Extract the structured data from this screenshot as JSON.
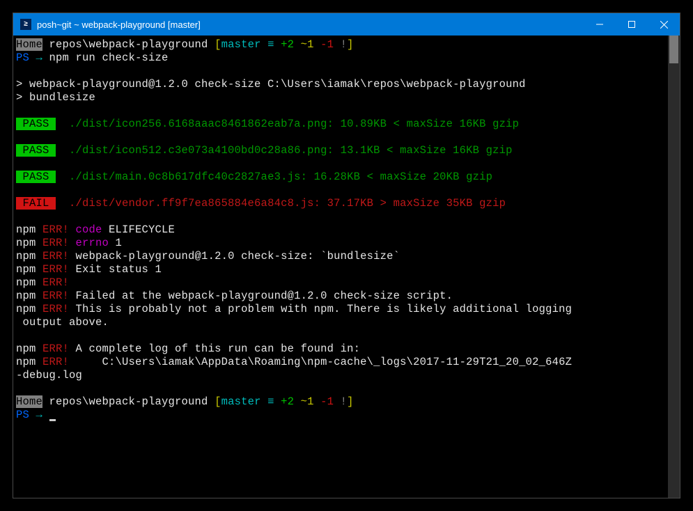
{
  "titlebar": {
    "title": "posh~git ~ webpack-playground [master]"
  },
  "prompt1": {
    "home": "Home",
    "path": " repos\\webpack-playground ",
    "branch_open": "[",
    "branch": "master",
    "equiv": " ≡ ",
    "plus": "+2 ",
    "tilde": "~1 ",
    "minus": "-1 ",
    "bang": "!",
    "branch_close": "]"
  },
  "psline1": {
    "ps": "PS ",
    "arrow": "→ ",
    "cmd": "npm run check-size"
  },
  "run": {
    "line1": "> webpack-playground@1.2.0 check-size C:\\Users\\iamak\\repos\\webpack-playground",
    "line2": "> bundlesize"
  },
  "results": [
    {
      "status": " PASS ",
      "pass": true,
      "text": "  ./dist/icon256.6168aaac8461862eab7a.png: 10.89KB < maxSize 16KB gzip"
    },
    {
      "status": " PASS ",
      "pass": true,
      "text": "  ./dist/icon512.c3e073a4100bd0c28a86.png: 13.1KB < maxSize 16KB gzip"
    },
    {
      "status": " PASS ",
      "pass": true,
      "text": "  ./dist/main.0c8b617dfc40c2827ae3.js: 16.28KB < maxSize 20KB gzip"
    },
    {
      "status": " FAIL ",
      "pass": false,
      "text": "  ./dist/vendor.ff9f7ea865884e6a84c8.js: 37.17KB > maxSize 35KB gzip"
    }
  ],
  "npm": "npm",
  "err": " ERR!",
  "errors": {
    "code_label": " code",
    "code_val": " ELIFECYCLE",
    "errno_label": " errno",
    "errno_val": " 1",
    "script": " webpack-playground@1.2.0 check-size: `bundlesize`",
    "exit": " Exit status 1",
    "failed": " Failed at the webpack-playground@1.2.0 check-size script.",
    "probably": " This is probably not a problem with npm. There is likely additional logging",
    "output": " output above.",
    "loghead": " A complete log of this run can be found in:",
    "logpath": "     C:\\Users\\iamak\\AppData\\Roaming\\npm-cache\\_logs\\2017-11-29T21_20_02_646Z",
    "logpath2": "-debug.log"
  },
  "psline2": {
    "ps": "PS ",
    "arrow": "→ "
  }
}
